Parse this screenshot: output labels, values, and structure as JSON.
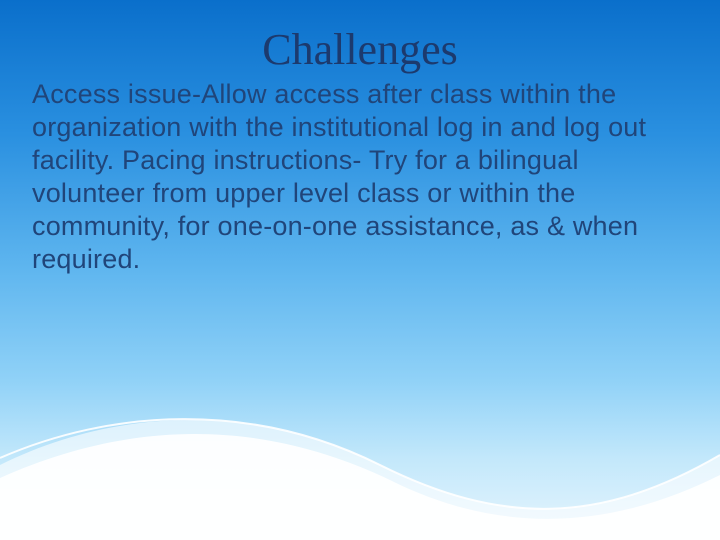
{
  "slide": {
    "title": "Challenges",
    "body": "Access issue-Allow access after class within the organization with the institutional log in and log out facility. Pacing instructions- Try for a bilingual volunteer from upper level class or within the community, for one-on-one assistance, as & when required."
  }
}
